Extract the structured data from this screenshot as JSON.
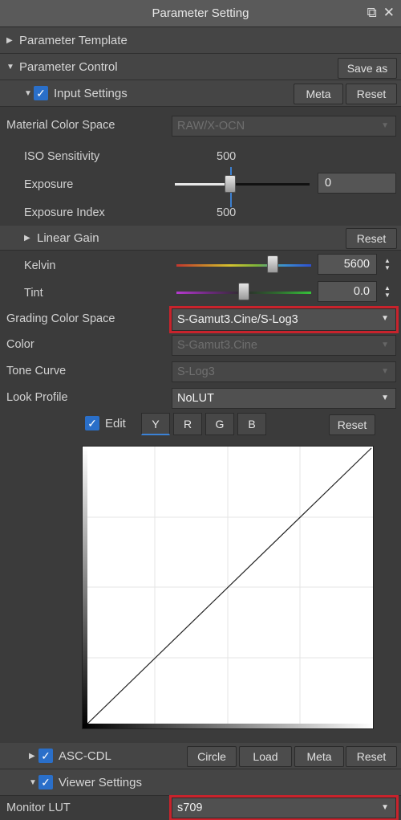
{
  "window": {
    "title": "Parameter Setting"
  },
  "sections": {
    "param_template": "Parameter Template",
    "param_control": "Parameter Control",
    "save_as": "Save as",
    "input_settings": "Input Settings",
    "meta": "Meta",
    "reset": "Reset"
  },
  "input": {
    "material_label": "Material Color Space",
    "material_value": "RAW/X-OCN",
    "iso_label": "ISO Sensitivity",
    "iso_value": "500",
    "exposure_label": "Exposure",
    "exposure_value": "0",
    "ei_label": "Exposure Index",
    "ei_value": "500",
    "linear_gain": "Linear Gain",
    "linear_reset": "Reset",
    "kelvin_label": "Kelvin",
    "kelvin_value": "5600",
    "tint_label": "Tint",
    "tint_value": "0.0",
    "grading_label": "Grading Color Space",
    "grading_value": "S-Gamut3.Cine/S-Log3",
    "color_label": "Color",
    "color_value": "S-Gamut3.Cine",
    "tone_label": "Tone Curve",
    "tone_value": "S-Log3",
    "look_label": "Look Profile",
    "look_value": "NoLUT"
  },
  "curve": {
    "edit_label": "Edit",
    "tabs": [
      "Y",
      "R",
      "G",
      "B"
    ],
    "active_tab": "Y",
    "reset": "Reset"
  },
  "asc": {
    "label": "ASC-CDL",
    "circle": "Circle",
    "load": "Load",
    "meta": "Meta",
    "reset": "Reset"
  },
  "viewer": {
    "label": "Viewer Settings",
    "monitor_label": "Monitor LUT",
    "monitor_value": "s709"
  },
  "colors": {
    "accent": "#2a6fc9",
    "highlight": "#c8232c"
  }
}
